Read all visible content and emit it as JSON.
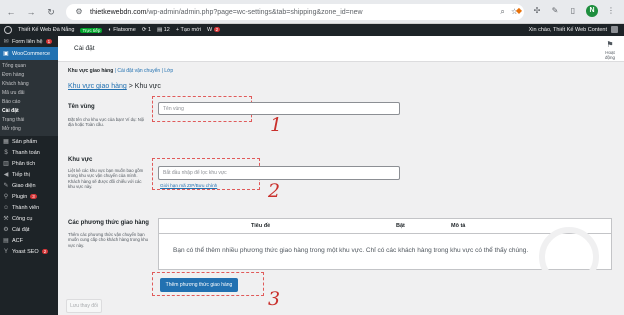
{
  "browser": {
    "url_host": "thietkewebdn.com",
    "url_path": "/wp-admin/admin.php?page=wc-settings&tab=shipping&zone_id=new",
    "profile_initial": "N"
  },
  "adminbar": {
    "site_name": "Thiết Kế Web Đà Nẵng",
    "live_badge": "Trực tiếp",
    "theme": "Flatsome",
    "updates": "1",
    "comments": "12",
    "new_label": "+ Tạo mới",
    "notif_count": "2",
    "greeting": "Xin chào, Thiết Kế Web Content"
  },
  "sidebar": {
    "contact": {
      "label": "Form liên hệ",
      "count": "1"
    },
    "woocommerce": "WooCommerce",
    "sub": [
      "Tổng quan",
      "Đơn hàng",
      "Khách hàng",
      "Mã ưu đãi",
      "Báo cáo",
      "Cài đặt",
      "Trạng thái",
      "Mở rộng"
    ],
    "items": [
      {
        "label": "Sản phẩm",
        "count": ""
      },
      {
        "label": "Thanh toán",
        "count": ""
      },
      {
        "label": "Phân tích",
        "count": ""
      },
      {
        "label": "Tiếp thị",
        "count": ""
      },
      {
        "label": "Giao diện",
        "count": ""
      },
      {
        "label": "Plugin",
        "count": "3"
      },
      {
        "label": "Thành viên",
        "count": ""
      },
      {
        "label": "Công cụ",
        "count": ""
      },
      {
        "label": "Cài đặt",
        "count": ""
      },
      {
        "label": "ACF",
        "count": ""
      },
      {
        "label": "Yoast SEO",
        "count": "2"
      }
    ]
  },
  "header": {
    "title": "Cài đặt",
    "activity": "Hoạt động"
  },
  "subtabs": {
    "zones": "Khu vực giao hàng",
    "sep1": " | ",
    "options": "Cài đặt vận chuyển",
    "sep2": " | ",
    "classes": "Lớp"
  },
  "breadcrumb": {
    "link": "Khu vực giao hàng",
    "current": " > Khu vực"
  },
  "zone_name": {
    "title": "Tên vùng",
    "desc": "Đặt tên cho khu vực của bạn! Ví dụ: Nội địa hoặc Toàn cầu.",
    "placeholder": "Tên vùng"
  },
  "zone_region": {
    "title": "Khu vực",
    "desc": "Liệt kê các khu vực bạn muốn bao gồm trong khu vực vận chuyển của mình. Khách hàng sẽ được đối chiếu với các khu vực này.",
    "placeholder": "Bắt đầu nhập để lọc khu vực",
    "zip_link": "Giới hạn mã ZIP/Bưu chính"
  },
  "methods": {
    "title": "Các phương thức giao hàng",
    "desc": "Thêm các phương thức vận chuyển bạn muốn cung cấp cho khách hàng trong khu vực này.",
    "col_title": "Tiêu đề",
    "col_enabled": "Bật",
    "col_desc": "Mô tả",
    "empty": "Bạn có thể thêm nhiều phương thức giao hàng trong một khu vực. Chỉ có các khách hàng trong khu vực có thể thấy chúng.",
    "add_button": "Thêm phương thức giao hàng"
  },
  "save_button": "Lưu thay đổi",
  "annotations": [
    "1",
    "2",
    "3"
  ]
}
